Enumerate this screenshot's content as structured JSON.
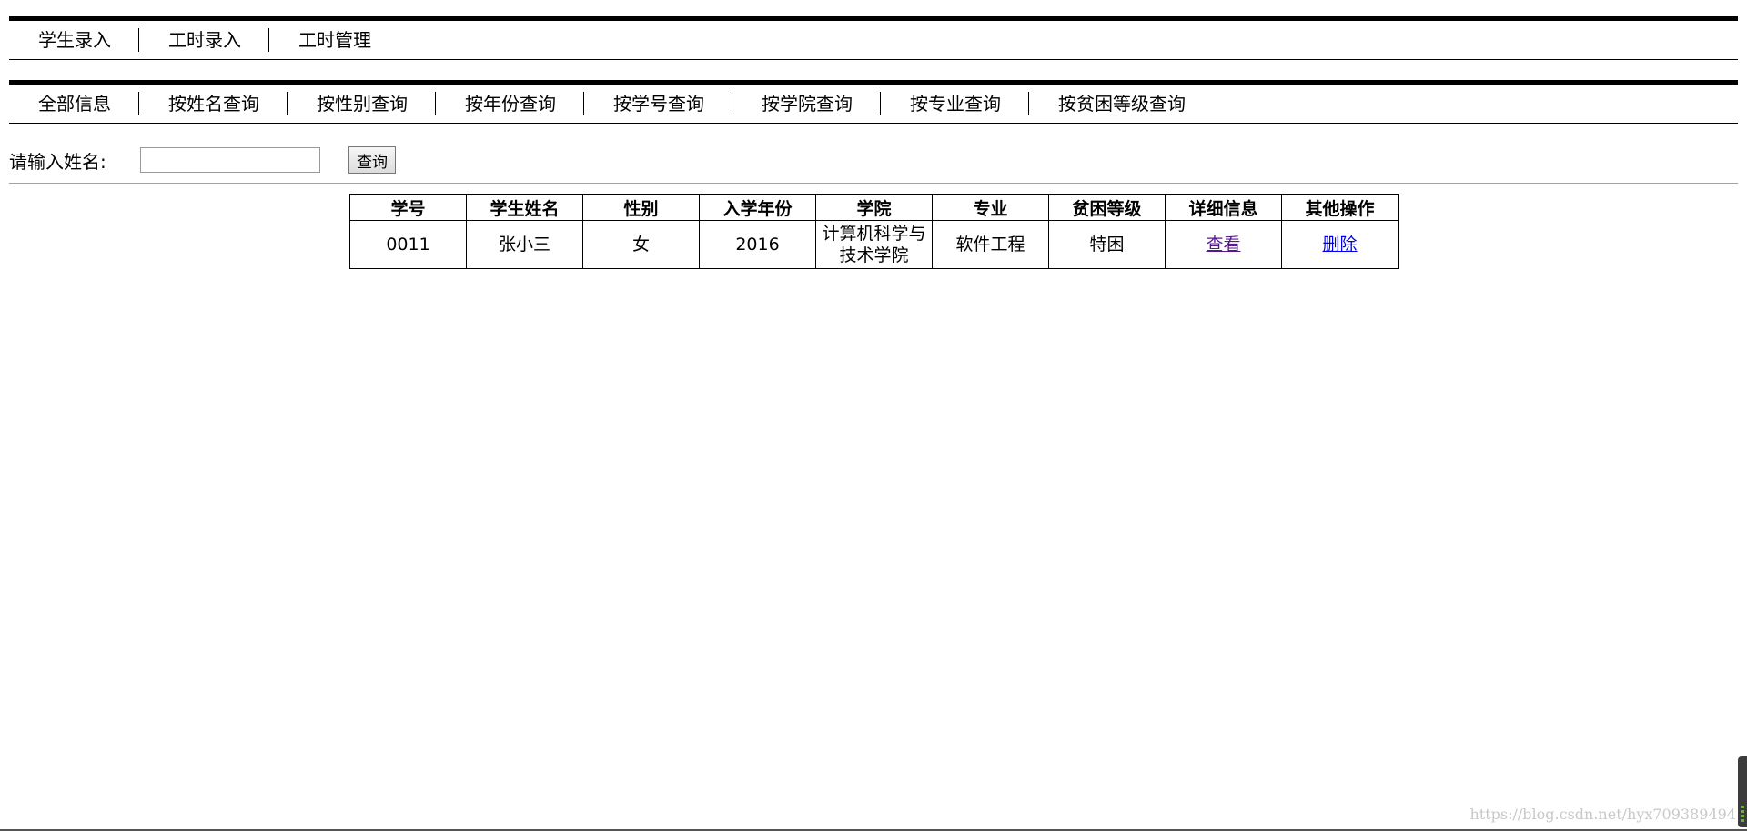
{
  "top_menu": {
    "items": [
      "学生录入",
      "工时录入",
      "工时管理"
    ]
  },
  "query_menu": {
    "items": [
      "全部信息",
      "按姓名查询",
      "按性别查询",
      "按年份查询",
      "按学号查询",
      "按学院查询",
      "按专业查询",
      "按贫困等级查询"
    ]
  },
  "search": {
    "label": "请输入姓名:",
    "value": "",
    "placeholder": "",
    "button_label": "查询"
  },
  "table": {
    "headers": [
      "学号",
      "学生姓名",
      "性别",
      "入学年份",
      "学院",
      "专业",
      "贫困等级",
      "详细信息",
      "其他操作"
    ],
    "rows": [
      {
        "id": "0011",
        "name": "张小三",
        "gender": "女",
        "year": "2016",
        "college": "计算机科学与技术学院",
        "major": "软件工程",
        "poverty_level": "特困",
        "detail_link": "查看",
        "action_link": "删除"
      }
    ]
  },
  "watermark": "https://blog.csdn.net/hyx709389494",
  "colors": {
    "visited_link": "#551a8b",
    "link": "#0000ee",
    "watermark": "#c8c8c8"
  }
}
